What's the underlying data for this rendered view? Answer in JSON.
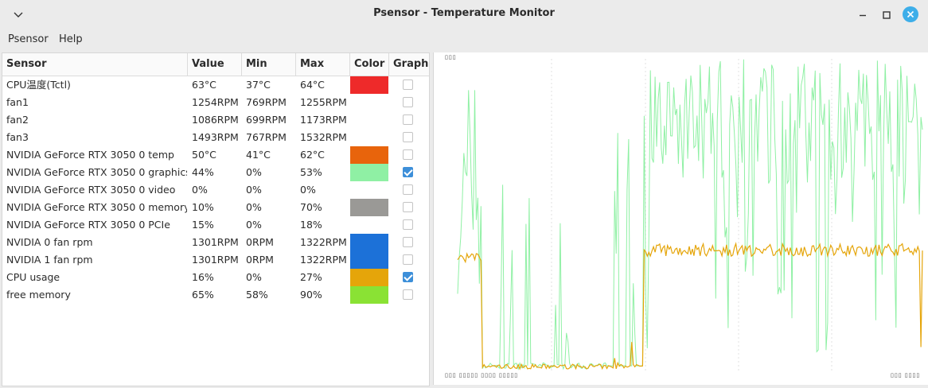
{
  "window": {
    "title": "Psensor - Temperature Monitor"
  },
  "menu": {
    "items": [
      {
        "label": "Psensor"
      },
      {
        "label": "Help"
      }
    ]
  },
  "table": {
    "headers": {
      "sensor": "Sensor",
      "value": "Value",
      "min": "Min",
      "max": "Max",
      "color": "Color",
      "graph": "Graph"
    },
    "rows": [
      {
        "sensor": "CPU温度(Tctl)",
        "value": "63°C",
        "min": "37°C",
        "max": "64°C",
        "color": "#ee2a2a",
        "graph": false
      },
      {
        "sensor": "fan1",
        "value": "1254RPM",
        "min": "769RPM",
        "max": "1255RPM",
        "color": "#ffffff",
        "graph": false
      },
      {
        "sensor": "fan2",
        "value": "1086RPM",
        "min": "699RPM",
        "max": "1173RPM",
        "color": "#ffffff",
        "graph": false
      },
      {
        "sensor": "fan3",
        "value": "1493RPM",
        "min": "767RPM",
        "max": "1532RPM",
        "color": "#ffffff",
        "graph": false
      },
      {
        "sensor": "NVIDIA GeForce RTX 3050 0 temp",
        "value": "50°C",
        "min": "41°C",
        "max": "62°C",
        "color": "#e8640c",
        "graph": false
      },
      {
        "sensor": "NVIDIA GeForce RTX 3050 0 graphics",
        "value": "44%",
        "min": "0%",
        "max": "53%",
        "color": "#8ff0a4",
        "graph": true
      },
      {
        "sensor": "NVIDIA GeForce RTX 3050 0 video",
        "value": "0%",
        "min": "0%",
        "max": "0%",
        "color": "#ffffff",
        "graph": false
      },
      {
        "sensor": "NVIDIA GeForce RTX 3050 0 memory",
        "value": "10%",
        "min": "0%",
        "max": "70%",
        "color": "#9a9996",
        "graph": false
      },
      {
        "sensor": "NVIDIA GeForce RTX 3050 0 PCIe",
        "value": "15%",
        "min": "0%",
        "max": "18%",
        "color": "#ffffff",
        "graph": false
      },
      {
        "sensor": "NVIDIA 0 fan rpm",
        "value": "1301RPM",
        "min": "0RPM",
        "max": "1322RPM",
        "color": "#1c71d8",
        "graph": false
      },
      {
        "sensor": "NVIDIA 1 fan rpm",
        "value": "1301RPM",
        "min": "0RPM",
        "max": "1322RPM",
        "color": "#1c71d8",
        "graph": false
      },
      {
        "sensor": "CPU usage",
        "value": "16%",
        "min": "0%",
        "max": "27%",
        "color": "#e5a50a",
        "graph": true
      },
      {
        "sensor": "free memory",
        "value": "65%",
        "min": "58%",
        "max": "90%",
        "color": "#8ae234",
        "graph": false
      }
    ]
  },
  "graph": {
    "background": "#ffffff",
    "grid_color": "#e0e0e0",
    "series": [
      {
        "color": "#8ff0a4"
      },
      {
        "color": "#e5a50a"
      }
    ]
  },
  "icons": {
    "menu": "chevron-down-icon",
    "minimize": "minimize-icon",
    "maximize": "maximize-icon",
    "close": "close-icon"
  }
}
